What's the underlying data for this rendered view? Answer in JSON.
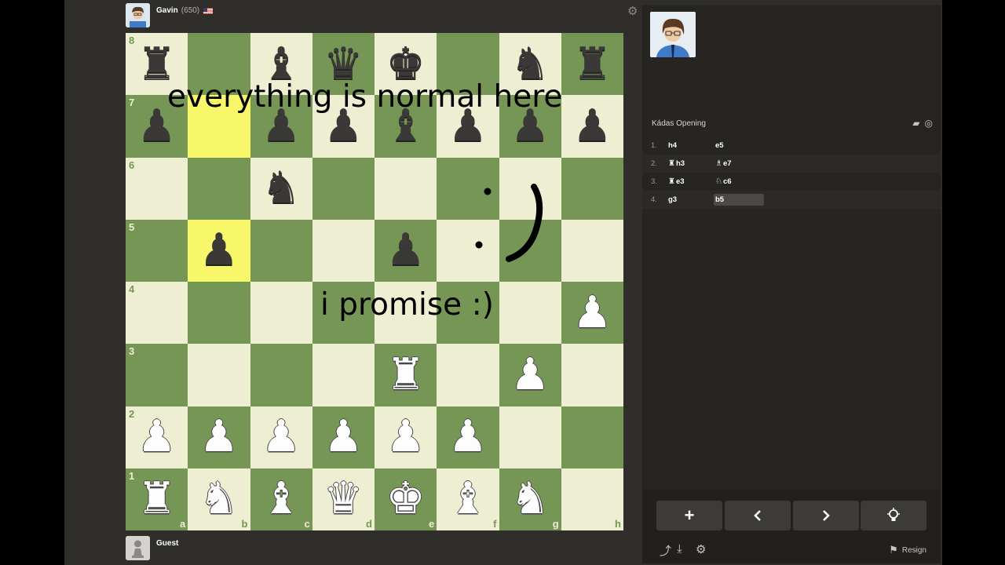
{
  "top_player": {
    "name": "Gavin",
    "rating": "(650)",
    "flag": "us-flag"
  },
  "bottom_player": {
    "name": "Guest"
  },
  "board": {
    "ranks": [
      "8",
      "7",
      "6",
      "5",
      "4",
      "3",
      "2",
      "1"
    ],
    "files": [
      "a",
      "b",
      "c",
      "d",
      "e",
      "f",
      "g",
      "h"
    ],
    "highlight_squares": [
      "b7",
      "b5"
    ],
    "position": [
      [
        "br",
        "",
        "bb",
        "bq",
        "bk",
        "",
        "bn",
        "br"
      ],
      [
        "bp",
        "",
        "bp",
        "bp",
        "bb",
        "bp",
        "bp",
        "bp"
      ],
      [
        "",
        "",
        "bn",
        "",
        "",
        "",
        "",
        ""
      ],
      [
        "",
        "bp",
        "",
        "",
        "bp",
        "",
        "",
        ""
      ],
      [
        "",
        "",
        "",
        "",
        "",
        "",
        "",
        "wp"
      ],
      [
        "",
        "",
        "",
        "",
        "wr",
        "",
        "wp",
        ""
      ],
      [
        "wp",
        "wp",
        "wp",
        "wp",
        "wp",
        "wp",
        "",
        ""
      ],
      [
        "wr",
        "wn",
        "wb",
        "wq",
        "wk",
        "wb",
        "wn",
        ""
      ]
    ],
    "colors": {
      "light": "#eeeed2",
      "dark": "#769656",
      "highlight": "#f7f769"
    }
  },
  "overlay": {
    "line1": "everything is normal here",
    "line2": "i promise :)"
  },
  "panel": {
    "opening": "Kádas Opening",
    "moves": [
      {
        "num": "1.",
        "white": "h4",
        "white_piece": "",
        "black": "e5",
        "black_piece": ""
      },
      {
        "num": "2.",
        "white": "h3",
        "white_piece": "♜",
        "black": "e7",
        "black_piece": "♗"
      },
      {
        "num": "3.",
        "white": "e3",
        "white_piece": "♜",
        "black": "c6",
        "black_piece": "♘"
      },
      {
        "num": "4.",
        "white": "g3",
        "white_piece": "",
        "black": "b5",
        "black_piece": ""
      }
    ],
    "active_move": "b5",
    "controls": {
      "new": "+",
      "prev": "‹",
      "next": "›",
      "hint": "lightbulb-icon"
    },
    "resign_label": "Resign"
  }
}
